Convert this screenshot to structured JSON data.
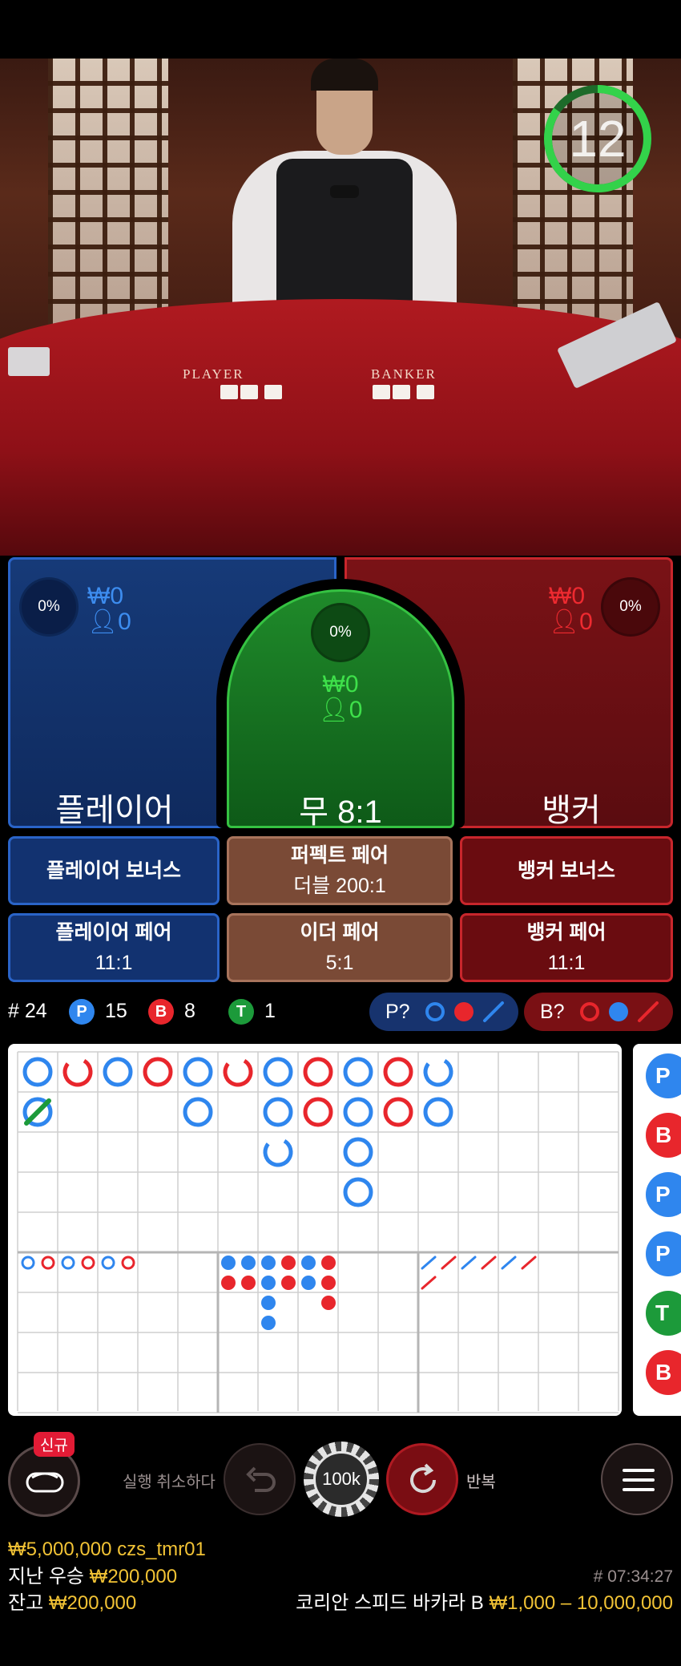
{
  "video": {
    "table_labels": {
      "player": "PLAYER",
      "banker": "BANKER"
    },
    "timer": "12"
  },
  "main_bets": {
    "player": {
      "percent": "0%",
      "amount": "₩0",
      "players": "0",
      "name": "플레이어"
    },
    "tie": {
      "percent": "0%",
      "amount": "₩0",
      "players": "0",
      "name": "무 8:1"
    },
    "banker": {
      "percent": "0%",
      "amount": "₩0",
      "players": "0",
      "name": "뱅커"
    }
  },
  "side_bets": {
    "player_bonus": "플레이어 보너스",
    "perfect_pair": {
      "title": "퍼펙트 페어",
      "payout": "더블 200:1"
    },
    "banker_bonus": "뱅커 보너스",
    "player_pair": {
      "title": "플레이어 페어",
      "payout": "11:1"
    },
    "either_pair": {
      "title": "이더 페어",
      "payout": "5:1"
    },
    "banker_pair": {
      "title": "뱅커 페어",
      "payout": "11:1"
    }
  },
  "stats": {
    "rounds": "# 24",
    "player_letter": "P",
    "player_count": "15",
    "banker_letter": "B",
    "banker_count": "8",
    "tie_letter": "T",
    "tie_count": "1",
    "player_predict": "P?",
    "banker_predict": "B?"
  },
  "colors": {
    "player": "#2f86ee",
    "banker": "#e8262c",
    "tie": "#1c9a3a",
    "accent_yellow": "#f2c335"
  },
  "roadmap": {
    "big_road": [
      {
        "col": 0,
        "row": 0,
        "result": "P"
      },
      {
        "col": 0,
        "row": 1,
        "result": "T"
      },
      {
        "col": 1,
        "row": 0,
        "result": "B-partial"
      },
      {
        "col": 2,
        "row": 0,
        "result": "P"
      },
      {
        "col": 3,
        "row": 0,
        "result": "B"
      },
      {
        "col": 4,
        "row": 0,
        "result": "P"
      },
      {
        "col": 4,
        "row": 1,
        "result": "P"
      },
      {
        "col": 5,
        "row": 0,
        "result": "B-partial"
      },
      {
        "col": 6,
        "row": 0,
        "result": "P"
      },
      {
        "col": 6,
        "row": 1,
        "result": "P"
      },
      {
        "col": 6,
        "row": 2,
        "result": "P-partial"
      },
      {
        "col": 7,
        "row": 0,
        "result": "B"
      },
      {
        "col": 7,
        "row": 1,
        "result": "B"
      },
      {
        "col": 8,
        "row": 0,
        "result": "P"
      },
      {
        "col": 8,
        "row": 1,
        "result": "P"
      },
      {
        "col": 8,
        "row": 2,
        "result": "P"
      },
      {
        "col": 8,
        "row": 3,
        "result": "P"
      },
      {
        "col": 9,
        "row": 0,
        "result": "B"
      },
      {
        "col": 9,
        "row": 1,
        "result": "B"
      },
      {
        "col": 10,
        "row": 0,
        "result": "P-partial"
      },
      {
        "col": 10,
        "row": 1,
        "result": "P"
      }
    ],
    "big_eye": [
      "P",
      "B",
      "P",
      "B",
      "P",
      "B"
    ],
    "small_road": [
      [
        "P",
        "B"
      ],
      [
        "P",
        "B"
      ],
      [
        "P",
        "P",
        "P",
        "P"
      ],
      [
        "B",
        "B"
      ],
      [
        "P",
        "P"
      ],
      [
        "B",
        "B",
        "B"
      ]
    ],
    "cockroach": [
      [
        "P",
        "B"
      ],
      [
        "B"
      ],
      [
        "P"
      ],
      [
        "B"
      ],
      [
        "P"
      ],
      [
        "B"
      ]
    ],
    "side_labels": [
      "P",
      "B",
      "P",
      "P",
      "T",
      "B"
    ]
  },
  "controls": {
    "new_badge": "신규",
    "undo_label": "실행 취소하다",
    "chip_value": "100k",
    "repeat_label": "반복"
  },
  "footer": {
    "balance_user": "₩5,000,000 czs_tmr01",
    "last_win_label": "지난 우승",
    "last_win_value": "₩200,000",
    "round_id": "# 07:34:27",
    "balance_label": "잔고",
    "balance_value": "₩200,000",
    "table_name": "코리안 스피드 바카라 B",
    "limits": "₩1,000 – 10,000,000"
  }
}
